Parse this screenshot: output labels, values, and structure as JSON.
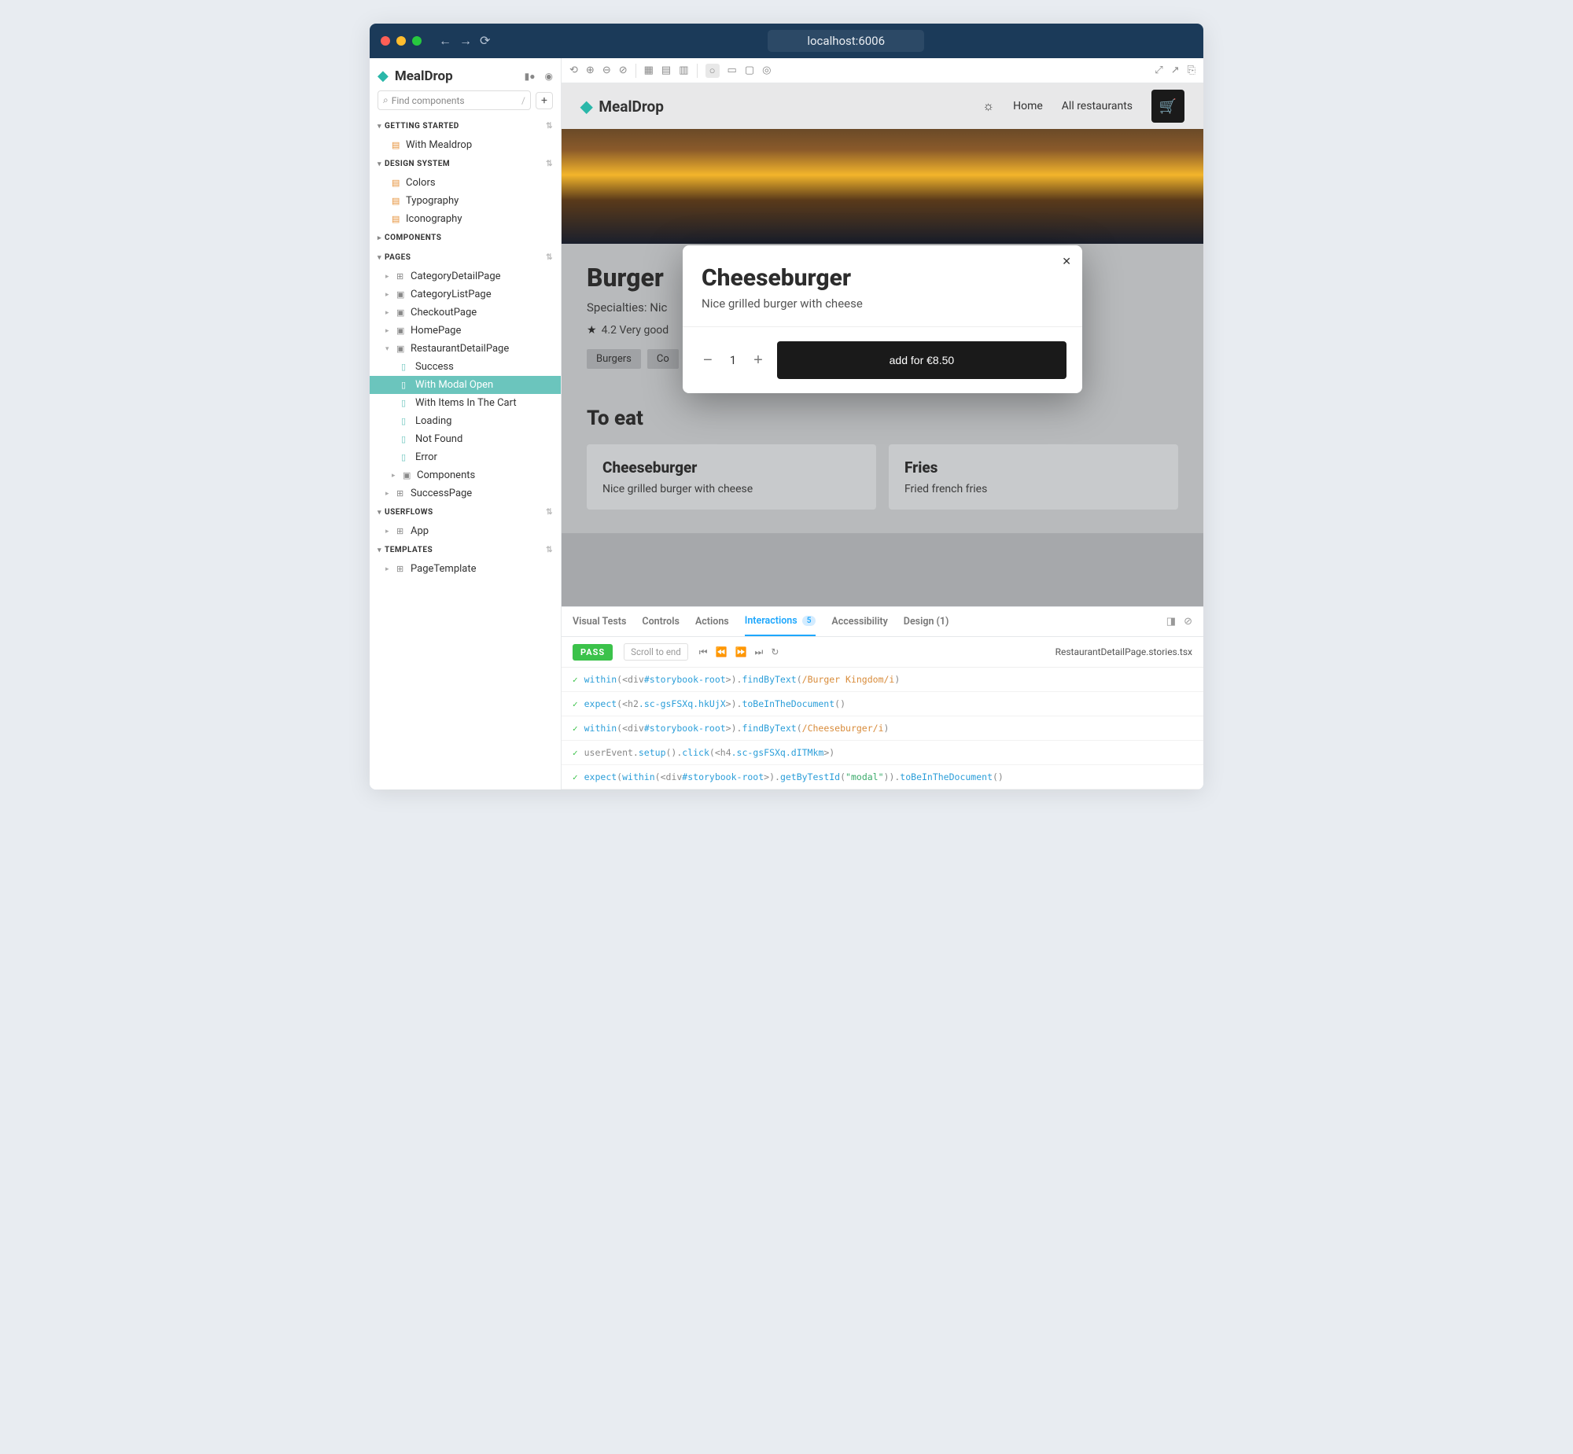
{
  "browser": {
    "url": "localhost:6006"
  },
  "sidebar": {
    "brand": "MealDrop",
    "search_placeholder": "Find components",
    "sections": {
      "getting_started": {
        "title": "Getting Started",
        "items": [
          "With Mealdrop"
        ]
      },
      "design_system": {
        "title": "Design System",
        "items": [
          "Colors",
          "Typography",
          "Iconography"
        ]
      },
      "components": {
        "title": "Components"
      },
      "pages": {
        "title": "Pages",
        "items": [
          {
            "label": "CategoryDetailPage",
            "icon": "grid"
          },
          {
            "label": "CategoryListPage",
            "icon": "folder"
          },
          {
            "label": "CheckoutPage",
            "icon": "folder"
          },
          {
            "label": "HomePage",
            "icon": "folder"
          },
          {
            "label": "RestaurantDetailPage",
            "icon": "folder",
            "expanded": true,
            "children": [
              {
                "label": "Success",
                "icon": "bookmark"
              },
              {
                "label": "With Modal Open",
                "icon": "bookmark",
                "selected": true
              },
              {
                "label": "With Items In The Cart",
                "icon": "bookmark"
              },
              {
                "label": "Loading",
                "icon": "bookmark"
              },
              {
                "label": "Not Found",
                "icon": "bookmark"
              },
              {
                "label": "Error",
                "icon": "bookmark"
              },
              {
                "label": "Components",
                "icon": "folder"
              }
            ]
          },
          {
            "label": "SuccessPage",
            "icon": "grid"
          }
        ]
      },
      "userflows": {
        "title": "Userflows",
        "items": [
          {
            "label": "App",
            "icon": "grid"
          }
        ]
      },
      "templates": {
        "title": "Templates",
        "items": [
          {
            "label": "PageTemplate",
            "icon": "grid"
          }
        ]
      }
    }
  },
  "app": {
    "brand": "MealDrop",
    "nav": {
      "home": "Home",
      "all": "All restaurants"
    },
    "restaurant": {
      "name": "Burger",
      "specialties_prefix": "Specialties: Nic",
      "rating": "4.2 Very good",
      "chips": [
        "Burgers",
        "Co"
      ]
    },
    "modal": {
      "title": "Cheeseburger",
      "desc": "Nice grilled burger with cheese",
      "qty": "1",
      "add_label": "add for €8.50"
    },
    "eat": {
      "heading": "To eat",
      "cards": [
        {
          "title": "Cheeseburger",
          "desc": "Nice grilled burger with cheese"
        },
        {
          "title": "Fries",
          "desc": "Fried french fries"
        }
      ]
    }
  },
  "addons": {
    "tabs": {
      "visual": "Visual Tests",
      "controls": "Controls",
      "actions": "Actions",
      "interactions": "Interactions",
      "interactions_count": "5",
      "a11y": "Accessibility",
      "design": "Design (1)"
    },
    "pass": "PASS",
    "scroll_end": "Scroll to end",
    "story_file": "RestaurantDetailPage.stories.tsx",
    "trace": [
      {
        "t1": "within",
        "t2": "(<",
        "t3": "div",
        "t4": "#storybook-root",
        "t5": ">).",
        "t6": "findByText",
        "t7": "(",
        "t8": "/Burger Kingdom/i",
        "t9": ")"
      },
      {
        "t1": "expect",
        "t2": "(<",
        "t3": "h2",
        "t4": ".sc-gsFSXq.hkUjX",
        "t5": ">).",
        "t6": "toBeInTheDocument",
        "t7": "()"
      },
      {
        "t1": "within",
        "t2": "(<",
        "t3": "div",
        "t4": "#storybook-root",
        "t5": ">).",
        "t6": "findByText",
        "t7": "(",
        "t8": "/Cheeseburger/i",
        "t9": ")"
      },
      {
        "t1": "userEvent.",
        "t1b": "setup",
        "t1c": "().",
        "t1d": "click",
        "t2": "(<",
        "t3": "h4",
        "t4": ".sc-gsFSXq.dITMkm",
        "t5": ">)"
      },
      {
        "t1": "expect",
        "t2": "(",
        "t1b": "within",
        "t2b": "(<",
        "t3": "div",
        "t4": "#storybook-root",
        "t5": ">).",
        "t6": "getByTestId",
        "t7": "(",
        "t8": "\"modal\"",
        "t9": ")).",
        "t10": "toBeInTheDocument",
        "t11": "()"
      }
    ]
  }
}
